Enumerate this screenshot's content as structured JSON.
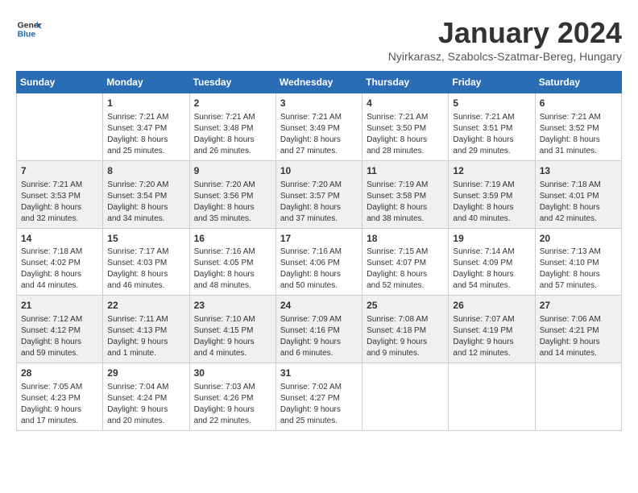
{
  "header": {
    "logo_line1": "General",
    "logo_line2": "Blue",
    "month": "January 2024",
    "location": "Nyirkarasz, Szabolcs-Szatmar-Bereg, Hungary"
  },
  "columns": [
    "Sunday",
    "Monday",
    "Tuesday",
    "Wednesday",
    "Thursday",
    "Friday",
    "Saturday"
  ],
  "weeks": [
    [
      {
        "day": "",
        "info": ""
      },
      {
        "day": "1",
        "info": "Sunrise: 7:21 AM\nSunset: 3:47 PM\nDaylight: 8 hours\nand 25 minutes."
      },
      {
        "day": "2",
        "info": "Sunrise: 7:21 AM\nSunset: 3:48 PM\nDaylight: 8 hours\nand 26 minutes."
      },
      {
        "day": "3",
        "info": "Sunrise: 7:21 AM\nSunset: 3:49 PM\nDaylight: 8 hours\nand 27 minutes."
      },
      {
        "day": "4",
        "info": "Sunrise: 7:21 AM\nSunset: 3:50 PM\nDaylight: 8 hours\nand 28 minutes."
      },
      {
        "day": "5",
        "info": "Sunrise: 7:21 AM\nSunset: 3:51 PM\nDaylight: 8 hours\nand 29 minutes."
      },
      {
        "day": "6",
        "info": "Sunrise: 7:21 AM\nSunset: 3:52 PM\nDaylight: 8 hours\nand 31 minutes."
      }
    ],
    [
      {
        "day": "7",
        "info": "Sunrise: 7:21 AM\nSunset: 3:53 PM\nDaylight: 8 hours\nand 32 minutes."
      },
      {
        "day": "8",
        "info": "Sunrise: 7:20 AM\nSunset: 3:54 PM\nDaylight: 8 hours\nand 34 minutes."
      },
      {
        "day": "9",
        "info": "Sunrise: 7:20 AM\nSunset: 3:56 PM\nDaylight: 8 hours\nand 35 minutes."
      },
      {
        "day": "10",
        "info": "Sunrise: 7:20 AM\nSunset: 3:57 PM\nDaylight: 8 hours\nand 37 minutes."
      },
      {
        "day": "11",
        "info": "Sunrise: 7:19 AM\nSunset: 3:58 PM\nDaylight: 8 hours\nand 38 minutes."
      },
      {
        "day": "12",
        "info": "Sunrise: 7:19 AM\nSunset: 3:59 PM\nDaylight: 8 hours\nand 40 minutes."
      },
      {
        "day": "13",
        "info": "Sunrise: 7:18 AM\nSunset: 4:01 PM\nDaylight: 8 hours\nand 42 minutes."
      }
    ],
    [
      {
        "day": "14",
        "info": "Sunrise: 7:18 AM\nSunset: 4:02 PM\nDaylight: 8 hours\nand 44 minutes."
      },
      {
        "day": "15",
        "info": "Sunrise: 7:17 AM\nSunset: 4:03 PM\nDaylight: 8 hours\nand 46 minutes."
      },
      {
        "day": "16",
        "info": "Sunrise: 7:16 AM\nSunset: 4:05 PM\nDaylight: 8 hours\nand 48 minutes."
      },
      {
        "day": "17",
        "info": "Sunrise: 7:16 AM\nSunset: 4:06 PM\nDaylight: 8 hours\nand 50 minutes."
      },
      {
        "day": "18",
        "info": "Sunrise: 7:15 AM\nSunset: 4:07 PM\nDaylight: 8 hours\nand 52 minutes."
      },
      {
        "day": "19",
        "info": "Sunrise: 7:14 AM\nSunset: 4:09 PM\nDaylight: 8 hours\nand 54 minutes."
      },
      {
        "day": "20",
        "info": "Sunrise: 7:13 AM\nSunset: 4:10 PM\nDaylight: 8 hours\nand 57 minutes."
      }
    ],
    [
      {
        "day": "21",
        "info": "Sunrise: 7:12 AM\nSunset: 4:12 PM\nDaylight: 8 hours\nand 59 minutes."
      },
      {
        "day": "22",
        "info": "Sunrise: 7:11 AM\nSunset: 4:13 PM\nDaylight: 9 hours\nand 1 minute."
      },
      {
        "day": "23",
        "info": "Sunrise: 7:10 AM\nSunset: 4:15 PM\nDaylight: 9 hours\nand 4 minutes."
      },
      {
        "day": "24",
        "info": "Sunrise: 7:09 AM\nSunset: 4:16 PM\nDaylight: 9 hours\nand 6 minutes."
      },
      {
        "day": "25",
        "info": "Sunrise: 7:08 AM\nSunset: 4:18 PM\nDaylight: 9 hours\nand 9 minutes."
      },
      {
        "day": "26",
        "info": "Sunrise: 7:07 AM\nSunset: 4:19 PM\nDaylight: 9 hours\nand 12 minutes."
      },
      {
        "day": "27",
        "info": "Sunrise: 7:06 AM\nSunset: 4:21 PM\nDaylight: 9 hours\nand 14 minutes."
      }
    ],
    [
      {
        "day": "28",
        "info": "Sunrise: 7:05 AM\nSunset: 4:23 PM\nDaylight: 9 hours\nand 17 minutes."
      },
      {
        "day": "29",
        "info": "Sunrise: 7:04 AM\nSunset: 4:24 PM\nDaylight: 9 hours\nand 20 minutes."
      },
      {
        "day": "30",
        "info": "Sunrise: 7:03 AM\nSunset: 4:26 PM\nDaylight: 9 hours\nand 22 minutes."
      },
      {
        "day": "31",
        "info": "Sunrise: 7:02 AM\nSunset: 4:27 PM\nDaylight: 9 hours\nand 25 minutes."
      },
      {
        "day": "",
        "info": ""
      },
      {
        "day": "",
        "info": ""
      },
      {
        "day": "",
        "info": ""
      }
    ]
  ]
}
